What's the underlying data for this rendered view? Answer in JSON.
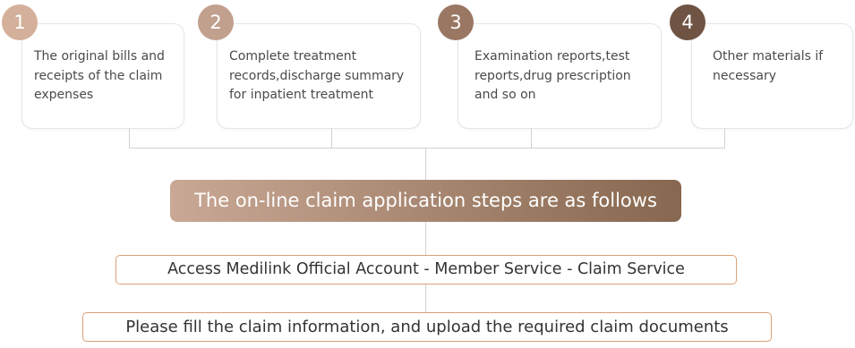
{
  "colors": {
    "badge_1": "#d4b09a",
    "badge_2": "#c2a08e",
    "badge_3": "#9a7763",
    "badge_4": "#6f5444",
    "banner_start": "#c9a895",
    "banner_end": "#87674f",
    "step_border": "#d9a077"
  },
  "cards": [
    {
      "number": "1",
      "text": "The original bills and receipts of the claim expenses"
    },
    {
      "number": "2",
      "text": "Complete treatment records,discharge summary for inpatient treatment"
    },
    {
      "number": "3",
      "text": "Examination reports,test reports,drug prescription and so on"
    },
    {
      "number": "4",
      "text": "Other materials if necessary"
    }
  ],
  "banner": {
    "text": "The on-line claim application steps are as follows"
  },
  "steps": [
    {
      "text": "Access Medilink Official Account - Member Service -  Claim Service"
    },
    {
      "text": "Please fill the claim information, and upload the required claim documents"
    }
  ]
}
